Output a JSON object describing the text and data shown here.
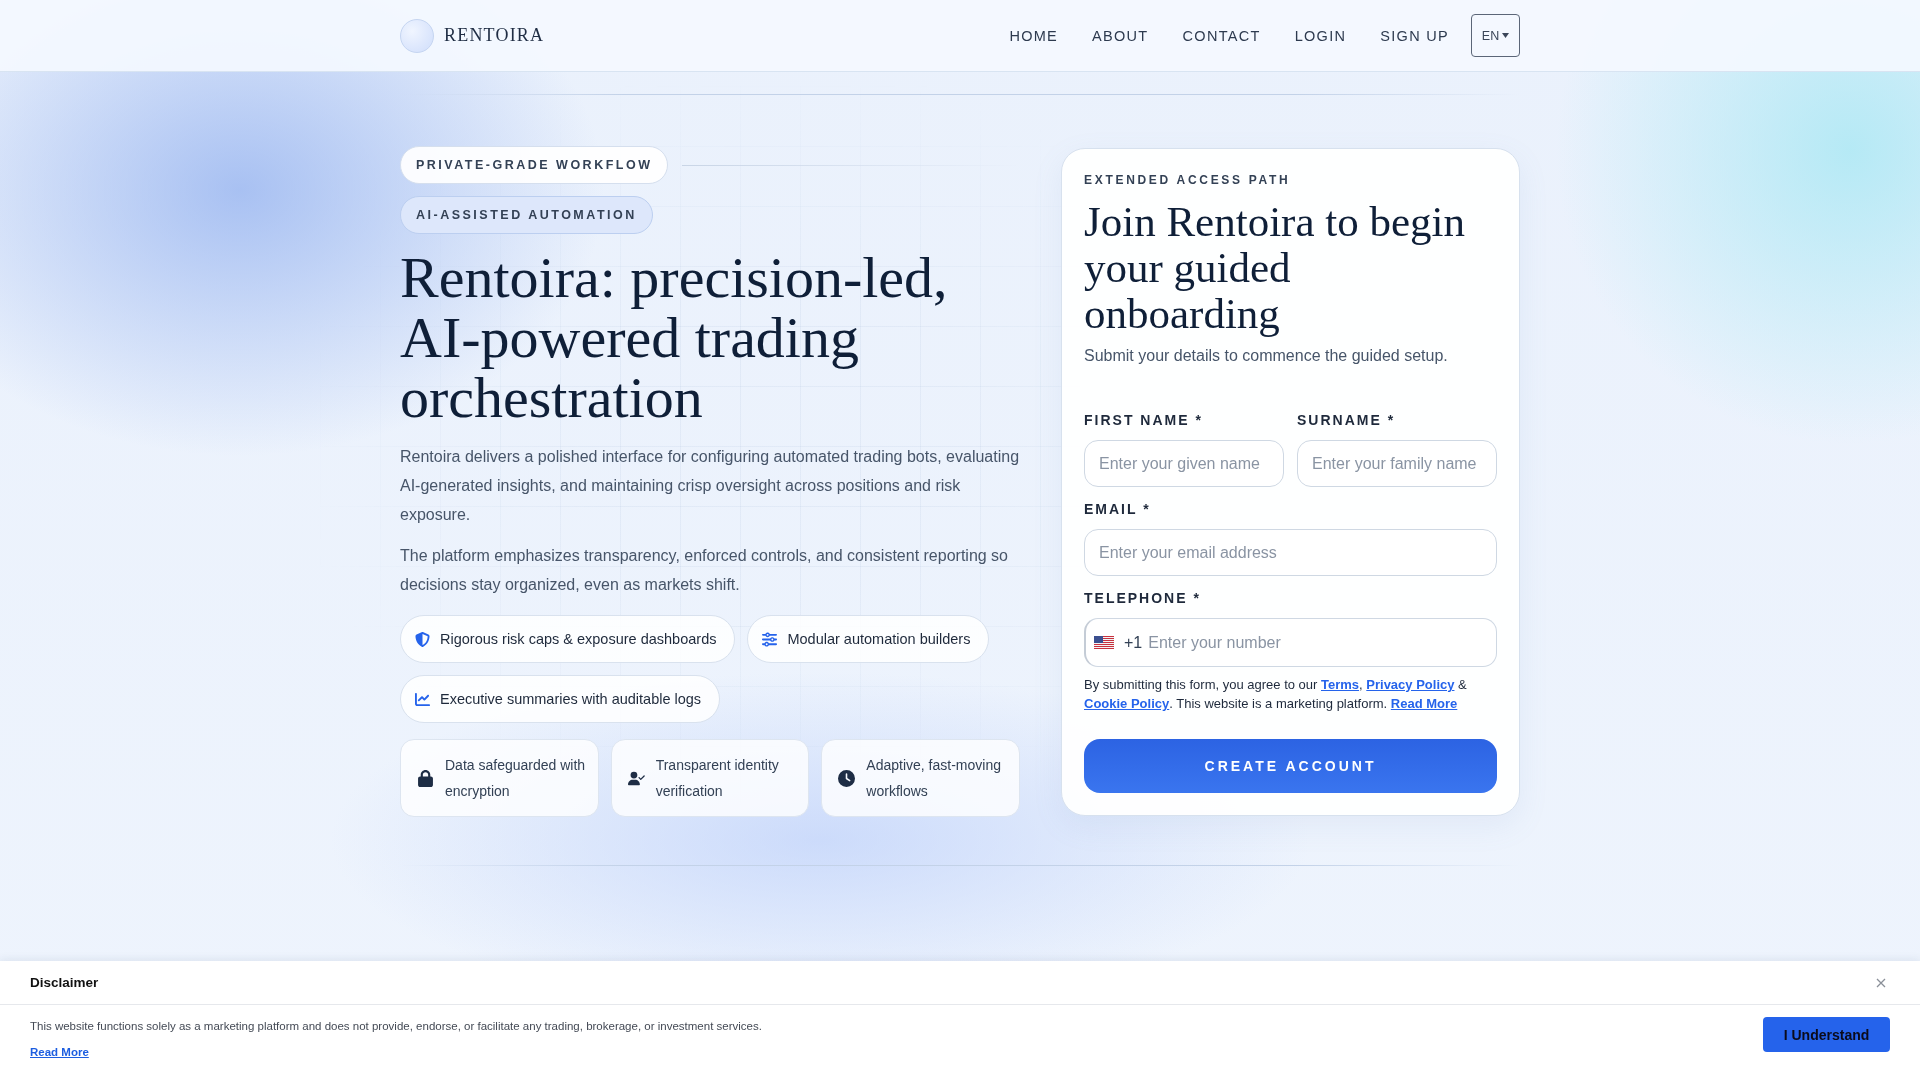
{
  "header": {
    "brand": "RENTOIRA",
    "nav": [
      {
        "label": "HOME"
      },
      {
        "label": "ABOUT"
      },
      {
        "label": "CONTACT"
      },
      {
        "label": "LOGIN"
      },
      {
        "label": "SIGN UP"
      }
    ],
    "language": "EN"
  },
  "hero": {
    "tags": [
      {
        "label": "PRIVATE-GRADE WORKFLOW",
        "kind": "outline"
      },
      {
        "label": "AI-ASSISTED AUTOMATION",
        "kind": "tinted"
      }
    ],
    "title": "Rentoira: precision-led, AI-powered trading orchestration",
    "paragraphs": [
      "Rentoira delivers a polished interface for configuring automated trading bots, evaluating AI-generated insights, and maintaining crisp oversight across positions and risk exposure.",
      "The platform emphasizes transparency, enforced controls, and consistent reporting so decisions stay organized, even as markets shift."
    ],
    "features": [
      "Rigorous risk caps & exposure dashboards",
      "Modular automation builders",
      "Executive summaries with auditable logs"
    ],
    "highlights": [
      "Data safeguarded with encryption",
      "Transparent identity verification",
      "Adaptive, fast-moving workflows"
    ]
  },
  "signup": {
    "eyebrow": "EXTENDED ACCESS PATH",
    "title": "Join Rentoira to begin your guided onboarding",
    "subtitle": "Submit your details to commence the guided setup.",
    "rows": [
      [
        {
          "kind": "text",
          "label": "FIRST NAME *",
          "placeholder": "Enter your given name"
        },
        {
          "kind": "text",
          "label": "SURNAME *",
          "placeholder": "Enter your family name"
        }
      ],
      [
        {
          "kind": "email",
          "label": "EMAIL *",
          "placeholder": "Enter your email address"
        }
      ],
      [
        {
          "kind": "phone",
          "label": "TELEPHONE *",
          "dial_code": "+1",
          "placeholder": "Enter your number"
        }
      ]
    ],
    "consent": [
      {
        "kind": "text",
        "text": "By submitting this form, you agree to our "
      },
      {
        "kind": "link",
        "text": "Terms"
      },
      {
        "kind": "text",
        "text": ", "
      },
      {
        "kind": "link",
        "text": "Privacy Policy"
      },
      {
        "kind": "text",
        "text": " & "
      },
      {
        "kind": "link",
        "text": "Cookie Policy"
      },
      {
        "kind": "text",
        "text": ". This website is a marketing platform. "
      },
      {
        "kind": "link",
        "text": "Read More"
      }
    ],
    "submit": "CREATE ACCOUNT"
  },
  "disclaimer": {
    "title": "Disclaimer",
    "text": "This website functions solely as a marketing platform and does not provide, endorse, or facilitate any trading, brokerage, or investment services.",
    "link": "Read More",
    "button": "I Understand"
  }
}
